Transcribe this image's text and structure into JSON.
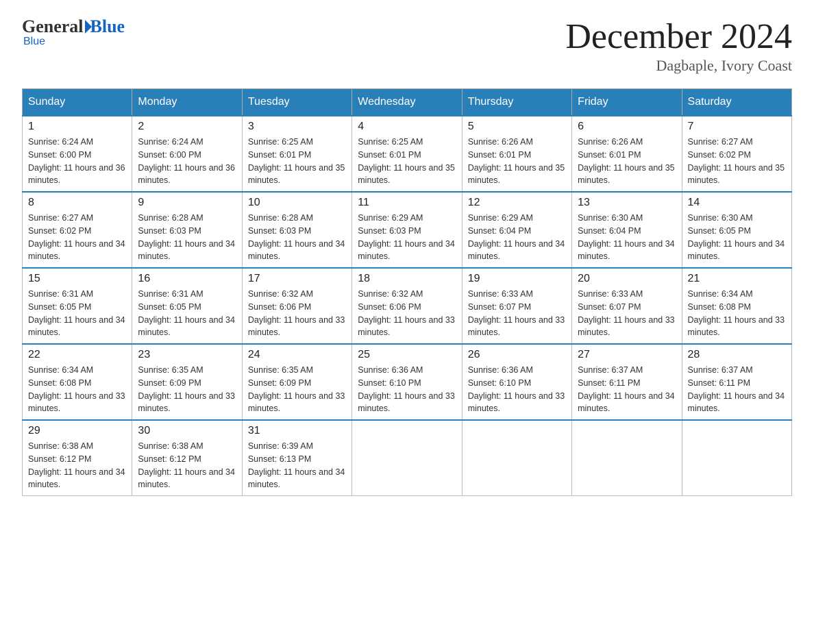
{
  "header": {
    "logo": {
      "general": "General",
      "blue": "Blue",
      "subtitle": "Blue"
    },
    "month": "December 2024",
    "location": "Dagbaple, Ivory Coast"
  },
  "weekdays": [
    "Sunday",
    "Monday",
    "Tuesday",
    "Wednesday",
    "Thursday",
    "Friday",
    "Saturday"
  ],
  "weeks": [
    [
      {
        "day": "1",
        "sunrise": "6:24 AM",
        "sunset": "6:00 PM",
        "daylight": "11 hours and 36 minutes."
      },
      {
        "day": "2",
        "sunrise": "6:24 AM",
        "sunset": "6:00 PM",
        "daylight": "11 hours and 36 minutes."
      },
      {
        "day": "3",
        "sunrise": "6:25 AM",
        "sunset": "6:01 PM",
        "daylight": "11 hours and 35 minutes."
      },
      {
        "day": "4",
        "sunrise": "6:25 AM",
        "sunset": "6:01 PM",
        "daylight": "11 hours and 35 minutes."
      },
      {
        "day": "5",
        "sunrise": "6:26 AM",
        "sunset": "6:01 PM",
        "daylight": "11 hours and 35 minutes."
      },
      {
        "day": "6",
        "sunrise": "6:26 AM",
        "sunset": "6:01 PM",
        "daylight": "11 hours and 35 minutes."
      },
      {
        "day": "7",
        "sunrise": "6:27 AM",
        "sunset": "6:02 PM",
        "daylight": "11 hours and 35 minutes."
      }
    ],
    [
      {
        "day": "8",
        "sunrise": "6:27 AM",
        "sunset": "6:02 PM",
        "daylight": "11 hours and 34 minutes."
      },
      {
        "day": "9",
        "sunrise": "6:28 AM",
        "sunset": "6:03 PM",
        "daylight": "11 hours and 34 minutes."
      },
      {
        "day": "10",
        "sunrise": "6:28 AM",
        "sunset": "6:03 PM",
        "daylight": "11 hours and 34 minutes."
      },
      {
        "day": "11",
        "sunrise": "6:29 AM",
        "sunset": "6:03 PM",
        "daylight": "11 hours and 34 minutes."
      },
      {
        "day": "12",
        "sunrise": "6:29 AM",
        "sunset": "6:04 PM",
        "daylight": "11 hours and 34 minutes."
      },
      {
        "day": "13",
        "sunrise": "6:30 AM",
        "sunset": "6:04 PM",
        "daylight": "11 hours and 34 minutes."
      },
      {
        "day": "14",
        "sunrise": "6:30 AM",
        "sunset": "6:05 PM",
        "daylight": "11 hours and 34 minutes."
      }
    ],
    [
      {
        "day": "15",
        "sunrise": "6:31 AM",
        "sunset": "6:05 PM",
        "daylight": "11 hours and 34 minutes."
      },
      {
        "day": "16",
        "sunrise": "6:31 AM",
        "sunset": "6:05 PM",
        "daylight": "11 hours and 34 minutes."
      },
      {
        "day": "17",
        "sunrise": "6:32 AM",
        "sunset": "6:06 PM",
        "daylight": "11 hours and 33 minutes."
      },
      {
        "day": "18",
        "sunrise": "6:32 AM",
        "sunset": "6:06 PM",
        "daylight": "11 hours and 33 minutes."
      },
      {
        "day": "19",
        "sunrise": "6:33 AM",
        "sunset": "6:07 PM",
        "daylight": "11 hours and 33 minutes."
      },
      {
        "day": "20",
        "sunrise": "6:33 AM",
        "sunset": "6:07 PM",
        "daylight": "11 hours and 33 minutes."
      },
      {
        "day": "21",
        "sunrise": "6:34 AM",
        "sunset": "6:08 PM",
        "daylight": "11 hours and 33 minutes."
      }
    ],
    [
      {
        "day": "22",
        "sunrise": "6:34 AM",
        "sunset": "6:08 PM",
        "daylight": "11 hours and 33 minutes."
      },
      {
        "day": "23",
        "sunrise": "6:35 AM",
        "sunset": "6:09 PM",
        "daylight": "11 hours and 33 minutes."
      },
      {
        "day": "24",
        "sunrise": "6:35 AM",
        "sunset": "6:09 PM",
        "daylight": "11 hours and 33 minutes."
      },
      {
        "day": "25",
        "sunrise": "6:36 AM",
        "sunset": "6:10 PM",
        "daylight": "11 hours and 33 minutes."
      },
      {
        "day": "26",
        "sunrise": "6:36 AM",
        "sunset": "6:10 PM",
        "daylight": "11 hours and 33 minutes."
      },
      {
        "day": "27",
        "sunrise": "6:37 AM",
        "sunset": "6:11 PM",
        "daylight": "11 hours and 34 minutes."
      },
      {
        "day": "28",
        "sunrise": "6:37 AM",
        "sunset": "6:11 PM",
        "daylight": "11 hours and 34 minutes."
      }
    ],
    [
      {
        "day": "29",
        "sunrise": "6:38 AM",
        "sunset": "6:12 PM",
        "daylight": "11 hours and 34 minutes."
      },
      {
        "day": "30",
        "sunrise": "6:38 AM",
        "sunset": "6:12 PM",
        "daylight": "11 hours and 34 minutes."
      },
      {
        "day": "31",
        "sunrise": "6:39 AM",
        "sunset": "6:13 PM",
        "daylight": "11 hours and 34 minutes."
      },
      null,
      null,
      null,
      null
    ]
  ]
}
